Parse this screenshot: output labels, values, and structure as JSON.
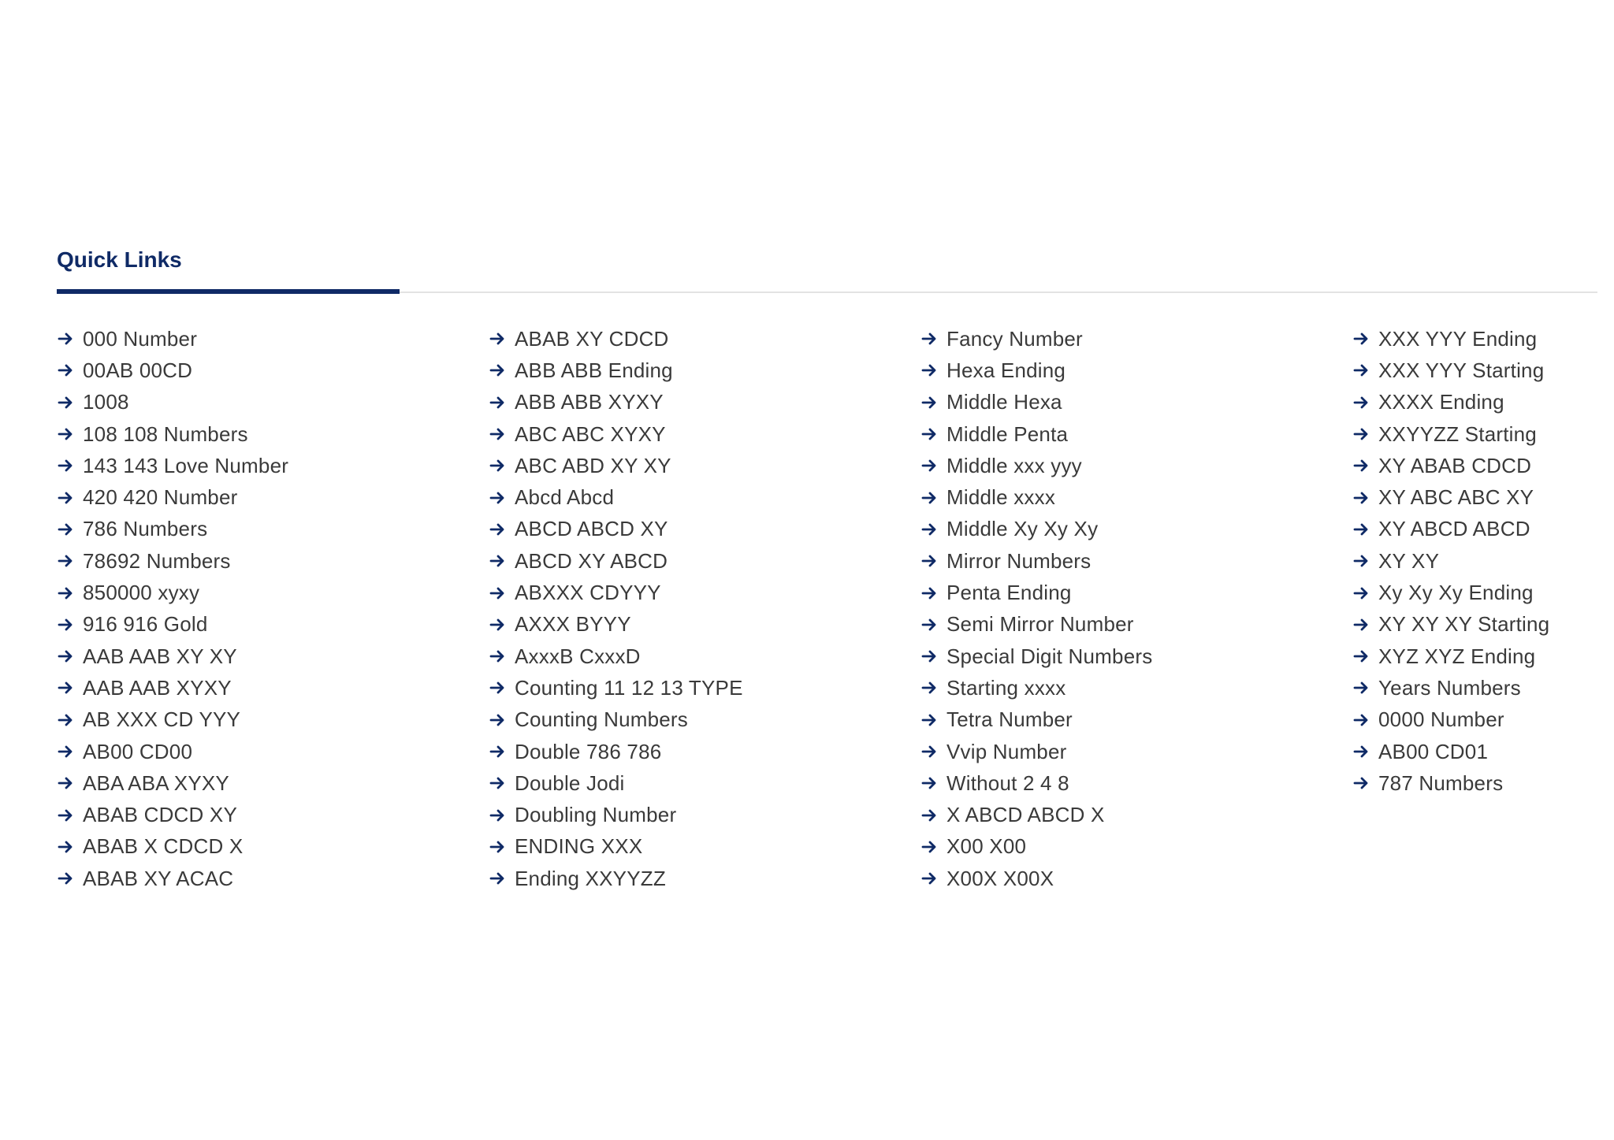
{
  "quick_links": {
    "title": "Quick Links",
    "accent_color": "#0f2a66",
    "item_icon": "arrow-right-icon",
    "columns": [
      [
        "000 Number",
        "00AB 00CD",
        "1008",
        "108 108 Numbers",
        "143 143 Love Number",
        "420 420 Number",
        "786 Numbers",
        "78692 Numbers",
        "850000 xyxy",
        "916 916 Gold",
        "AAB AAB XY XY",
        "AAB AAB XYXY",
        "AB XXX CD YYY",
        "AB00 CD00",
        "ABA ABA XYXY",
        "ABAB CDCD XY",
        "ABAB X CDCD X",
        "ABAB XY ACAC"
      ],
      [
        "ABAB XY CDCD",
        "ABB ABB Ending",
        "ABB ABB XYXY",
        "ABC ABC XYXY",
        "ABC ABD XY XY",
        "Abcd Abcd",
        "ABCD ABCD XY",
        "ABCD XY ABCD",
        "ABXXX CDYYY",
        "AXXX BYYY",
        "AxxxB CxxxD",
        "Counting 11 12 13 TYPE",
        "Counting Numbers",
        "Double 786 786",
        "Double Jodi",
        "Doubling Number",
        "ENDING XXX",
        "Ending XXYYZZ"
      ],
      [
        "Fancy Number",
        "Hexa Ending",
        "Middle Hexa",
        "Middle Penta",
        "Middle xxx yyy",
        "Middle xxxx",
        "Middle Xy Xy Xy",
        "Mirror Numbers",
        "Penta Ending",
        "Semi Mirror Number",
        "Special Digit Numbers",
        "Starting xxxx",
        "Tetra Number",
        "Vvip Number",
        "Without 2 4 8",
        "X ABCD ABCD X",
        "X00 X00",
        "X00X X00X"
      ],
      [
        "XXX YYY Ending",
        "XXX YYY Starting",
        "XXXX Ending",
        "XXYYZZ Starting",
        "XY ABAB CDCD",
        "XY ABC ABC XY",
        "XY ABCD ABCD",
        "XY XY",
        "Xy Xy Xy Ending",
        "XY XY XY Starting",
        "XYZ XYZ Ending",
        "Years Numbers",
        "0000 Number",
        "AB00 CD01",
        "787 Numbers"
      ]
    ]
  }
}
